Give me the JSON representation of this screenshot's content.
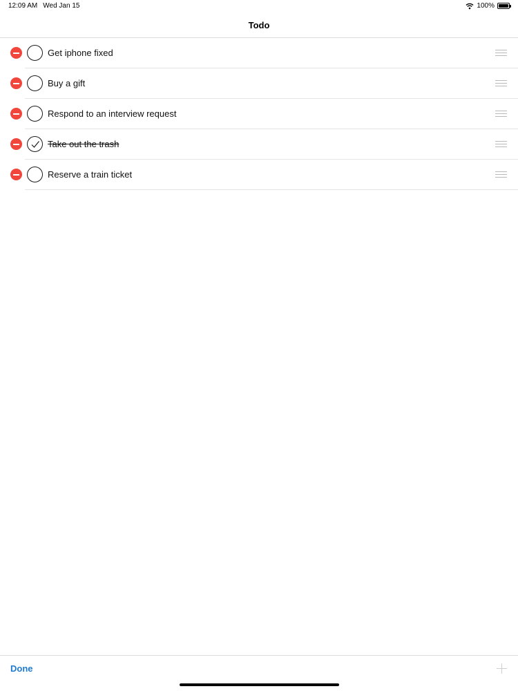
{
  "status_bar": {
    "time": "12:09 AM",
    "date": "Wed Jan 15",
    "battery_text": "100%",
    "wifi_icon": "wifi-icon",
    "battery_icon": "battery-icon"
  },
  "nav": {
    "title": "Todo"
  },
  "todos": [
    {
      "label": "Get iphone fixed",
      "completed": false
    },
    {
      "label": "Buy a gift",
      "completed": false
    },
    {
      "label": "Respond to an interview request",
      "completed": false
    },
    {
      "label": "Take out the trash",
      "completed": true
    },
    {
      "label": "Reserve a train ticket",
      "completed": false
    }
  ],
  "toolbar": {
    "done_label": "Done",
    "add_icon": "plus-icon"
  },
  "colors": {
    "delete": "#f0463c",
    "accent": "#1f7ad1"
  }
}
